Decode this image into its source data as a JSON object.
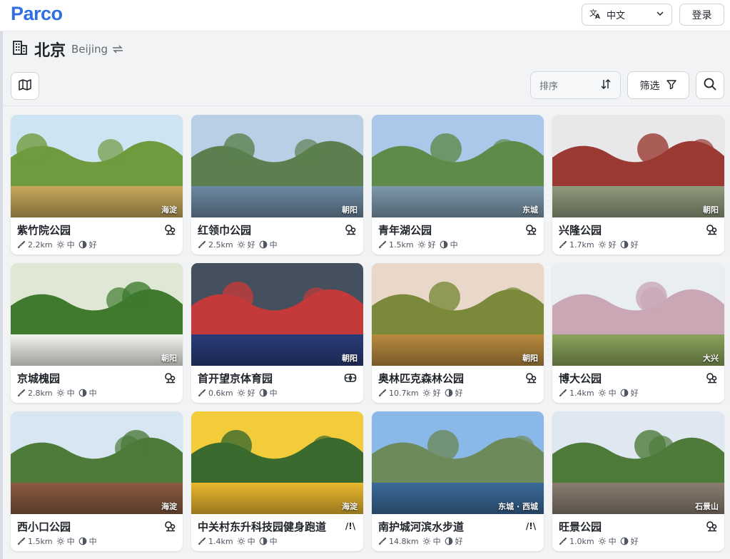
{
  "app": {
    "logo": "Parco"
  },
  "header": {
    "language": "中文",
    "login_label": "登录"
  },
  "city": {
    "name_zh": "北京",
    "name_en": "Beijing"
  },
  "toolbar": {
    "sort_placeholder": "排序",
    "filter_label": "筛选"
  },
  "colors": {
    "brand": "#2f6fe0",
    "card_bg": "#ffffff",
    "page_bg": "#f2f3f5"
  },
  "parks": [
    {
      "name": "紫竹院公园",
      "district": "海淀",
      "distance": "2.2km",
      "light": "中",
      "shade": "好",
      "type_icon": "tree-icon"
    },
    {
      "name": "红领巾公园",
      "district": "朝阳",
      "distance": "2.5km",
      "light": "好",
      "shade": "中",
      "type_icon": "tree-icon"
    },
    {
      "name": "青年湖公园",
      "district": "东城",
      "distance": "1.5km",
      "light": "好",
      "shade": "中",
      "type_icon": "tree-icon"
    },
    {
      "name": "兴隆公园",
      "district": "朝阳",
      "distance": "1.7km",
      "light": "好",
      "shade": "好",
      "type_icon": "tree-icon"
    },
    {
      "name": "京城槐园",
      "district": "朝阳",
      "distance": "2.8km",
      "light": "中",
      "shade": "中",
      "type_icon": "tree-icon"
    },
    {
      "name": "首开望京体育园",
      "district": "朝阳",
      "distance": "0.6km",
      "light": "好",
      "shade": "中",
      "type_icon": "stadium-icon"
    },
    {
      "name": "奥林匹克森林公园",
      "district": "朝阳",
      "distance": "10.7km",
      "light": "好",
      "shade": "好",
      "type_icon": "tree-icon"
    },
    {
      "name": "博大公园",
      "district": "大兴",
      "distance": "1.4km",
      "light": "中",
      "shade": "好",
      "type_icon": "tree-icon"
    },
    {
      "name": "西小口公园",
      "district": "海淀",
      "distance": "1.5km",
      "light": "中",
      "shade": "中",
      "type_icon": "tree-icon"
    },
    {
      "name": "中关村东升科技园健身跑道",
      "district": "海淀",
      "distance": "1.4km",
      "light": "中",
      "shade": "中",
      "type_icon": "path-icon",
      "type_text": "/!\\"
    },
    {
      "name": "南护城河滨水步道",
      "district": "东城 · 西城",
      "distance": "14.8km",
      "light": "中",
      "shade": "好",
      "type_icon": "path-icon",
      "type_text": "/!\\"
    },
    {
      "name": "旺景公园",
      "district": "石景山",
      "distance": "1.0km",
      "light": "中",
      "shade": "好",
      "type_icon": "tree-icon"
    }
  ]
}
